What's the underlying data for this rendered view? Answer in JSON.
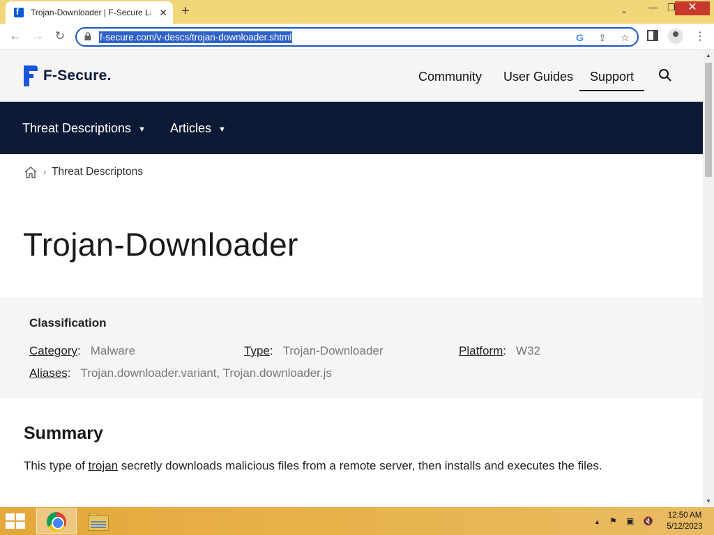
{
  "browser": {
    "tab_title": "Trojan-Downloader | F-Secure La",
    "tab_close": "✕",
    "new_tab": "+",
    "url": "f-secure.com/v-descs/trojan-downloader.shtml",
    "window": {
      "minimize": "—",
      "maximize": "❐",
      "close": "✕"
    }
  },
  "site": {
    "logo_text": "F-Secure.",
    "top_nav": [
      "Community",
      "User Guides",
      "Support"
    ],
    "active_nav": "Support",
    "sub_nav": [
      "Threat Descriptions",
      "Articles"
    ],
    "breadcrumb": [
      "Threat Descriptons"
    ]
  },
  "page": {
    "title": "Trojan-Downloader",
    "classification": {
      "heading": "Classification",
      "category_label": "Category",
      "category_value": "Malware",
      "type_label": "Type",
      "type_value": "Trojan-Downloader",
      "platform_label": "Platform",
      "platform_value": "W32",
      "aliases_label": "Aliases",
      "aliases_value": "Trojan.downloader.variant, Trojan.downloader.js"
    },
    "summary": {
      "heading": "Summary",
      "text_before": "This type of ",
      "link": "trojan",
      "text_after": " secretly downloads malicious files from a remote server, then installs and executes the files."
    }
  },
  "taskbar": {
    "time": "12:50 AM",
    "date": "5/12/2023"
  },
  "colors": {
    "brand_blue": "#1a56d8",
    "sub_nav_bg": "#0c1a35",
    "chrome_frame": "#f2d67a"
  }
}
